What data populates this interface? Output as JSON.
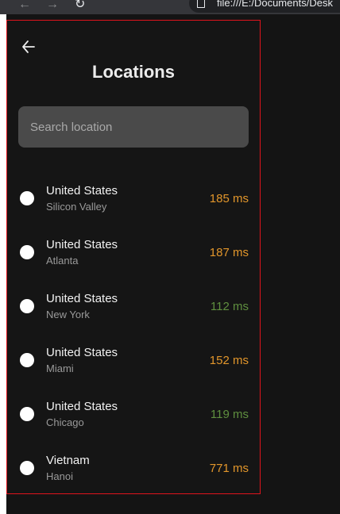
{
  "browser": {
    "back_icon": "arrow-left-icon",
    "forward_icon": "arrow-right-icon",
    "reload_icon": "reload-icon",
    "url": "file:///E:/Documents/Desk"
  },
  "panel": {
    "back_icon": "arrow-left-icon",
    "title": "Locations",
    "search_placeholder": "Search location",
    "border_color": "#e0141d"
  },
  "locations": [
    {
      "country": "United States",
      "city": "Silicon Valley",
      "ping": "185 ms",
      "ping_color": "#e2962b"
    },
    {
      "country": "United States",
      "city": "Atlanta",
      "ping": "187 ms",
      "ping_color": "#e2962b"
    },
    {
      "country": "United States",
      "city": "New York",
      "ping": "112 ms",
      "ping_color": "#5f8f3f"
    },
    {
      "country": "United States",
      "city": "Miami",
      "ping": "152 ms",
      "ping_color": "#e2962b"
    },
    {
      "country": "United States",
      "city": "Chicago",
      "ping": "119 ms",
      "ping_color": "#5f8f3f"
    },
    {
      "country": "Vietnam",
      "city": "Hanoi",
      "ping": "771 ms",
      "ping_color": "#e2962b"
    }
  ]
}
